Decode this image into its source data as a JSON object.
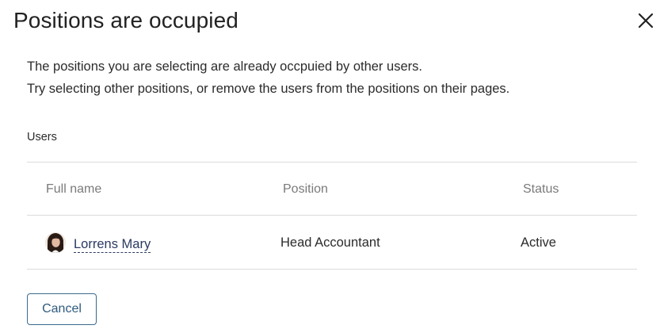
{
  "dialog": {
    "title": "Positions are occupied",
    "close_icon": "close-icon",
    "message_line1": "The positions you are selecting are already occpuied by other users.",
    "message_line2": "Try selecting other positions, or remove the users from the positions on their pages."
  },
  "users_section": {
    "label": "Users",
    "columns": {
      "full_name": "Full name",
      "position": "Position",
      "status": "Status"
    },
    "rows": [
      {
        "avatar": "user-avatar",
        "full_name": "Lorrens Mary",
        "position": "Head Accountant",
        "status": "Active"
      }
    ]
  },
  "footer": {
    "cancel_label": "Cancel"
  },
  "colors": {
    "link": "#2c3a63",
    "button_border": "#3a6a8e",
    "divider": "#dcdcdc",
    "header_text": "#7a7a7a"
  }
}
